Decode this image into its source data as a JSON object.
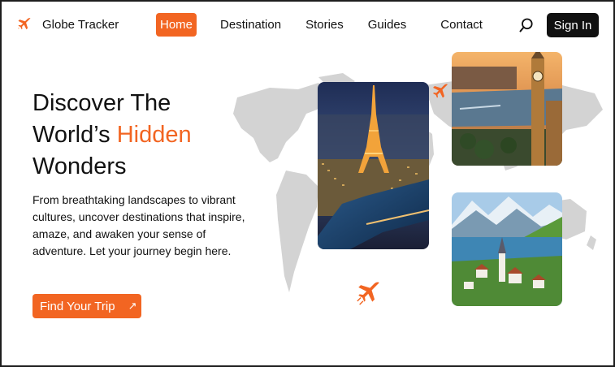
{
  "brand": {
    "name": "Globe Tracker",
    "icon": "airplane-icon",
    "accent_color": "#f26522"
  },
  "nav": {
    "items": [
      {
        "label": "Home",
        "active": true
      },
      {
        "label": "Destination",
        "active": false
      },
      {
        "label": "Stories",
        "active": false
      },
      {
        "label": "Guides",
        "active": false
      },
      {
        "label": "Contact",
        "active": false
      }
    ],
    "search_icon": "search-icon",
    "signin_label": "Sign In"
  },
  "hero": {
    "headline_line1": "Discover The",
    "headline_line2_prefix": "World’s ",
    "headline_line2_accent": "Hidden",
    "headline_line3": "Wonders",
    "description": "From breathtaking landscapes to vibrant cultures, uncover destinations that inspire, amaze, and awaken your sense of adventure. Let your journey begin here.",
    "cta_label": "Find Your Trip",
    "cta_icon": "arrow-up-right-icon"
  },
  "photos": [
    {
      "name": "paris-eiffel-tower-photo"
    },
    {
      "name": "london-big-ben-photo"
    },
    {
      "name": "swiss-lake-village-photo"
    }
  ]
}
